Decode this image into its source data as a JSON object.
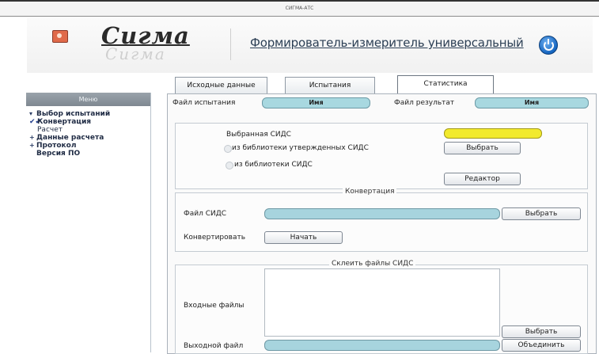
{
  "window": {
    "title": "СИГМА-АТС"
  },
  "header": {
    "logo": "Сигма",
    "title": "Формирователь-измеритель универсальный"
  },
  "sidebar": {
    "menu_label": "Меню",
    "items": [
      {
        "label": "Выбор испытаний",
        "marker": "▾"
      },
      {
        "label": "Конвертация",
        "marker": "✔✔"
      },
      {
        "label": "Расчет",
        "marker": ""
      },
      {
        "label": "Данные расчета",
        "marker": "+"
      },
      {
        "label": "Протокол",
        "marker": "+"
      },
      {
        "label": "Версия ПО",
        "marker": ""
      }
    ]
  },
  "tabs": [
    {
      "label": "Исходные данные"
    },
    {
      "label": "Испытания"
    },
    {
      "label": "Статистика"
    }
  ],
  "top": {
    "test_file_label": "Файл испытания",
    "test_file_value": "Имя",
    "result_file_label": "Файл результат",
    "result_file_value": "Имя"
  },
  "sids": {
    "selected_label": "Выбранная СИДС",
    "option_approved": "из библиотеки утвержденных СИДС",
    "option_library": "из библиотеки СИДС",
    "choose_label": "Выбрать",
    "editor_label": "Редактор",
    "selected_color": "#f2ea2d"
  },
  "conversion": {
    "legend": "Конвертация",
    "file_label": "Файл СИДС",
    "choose_label": "Выбрать",
    "convert_label": "Конвертировать",
    "start_label": "Начать"
  },
  "merge": {
    "legend": "Склеить файлы СИДС",
    "input_label": "Входные файлы",
    "output_label": "Выходной файл",
    "choose_label": "Выбрать",
    "merge_label": "Объединить"
  }
}
